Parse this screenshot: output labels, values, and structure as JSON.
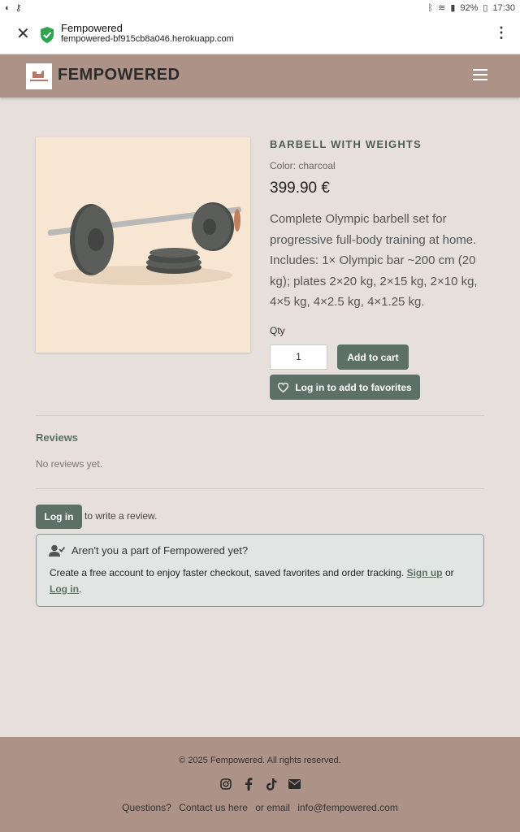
{
  "statusbar": {
    "battery": "92%",
    "time": "17:30"
  },
  "browser": {
    "title": "Fempowered",
    "url": "fempowered-bf915cb8a046.herokuapp.com"
  },
  "navbar": {
    "brand": "FEMPOWERED"
  },
  "product": {
    "title": "BARBELL WITH WEIGHTS",
    "color": "Color: charcoal",
    "price": "399.90 €",
    "description": "Complete Olympic barbell set for progressive full-body training at home. Includes: 1× Olympic bar ~200 cm (20 kg); plates 2×20 kg, 2×15 kg, 2×10 kg, 4×5 kg, 4×2.5 kg, 4×1.25 kg.",
    "qty_label": "Qty",
    "qty_value": "1",
    "add_to_cart": "Add to cart",
    "favorites": "Log in to add to favorites"
  },
  "reviews": {
    "title": "Reviews",
    "empty": "No reviews yet.",
    "login": "Log in",
    "write_prompt": "to write a review."
  },
  "notice": {
    "title": "Aren't you a part of Fempowered yet?",
    "text": "Create a free account to enjoy faster checkout, saved favorites and order tracking.",
    "signup": "Sign up",
    "or": "or",
    "login": "Log in",
    "end": "."
  },
  "footer": {
    "copyright": "© 2025 Fempowered. All rights reserved.",
    "questions": "Questions?",
    "contact": "Contact us here",
    "or_email": "or email",
    "email": "info@fempowered.com"
  },
  "colors": {
    "nav": "#ad9288",
    "accent": "#5d7065",
    "background": "#e6dfdb"
  }
}
